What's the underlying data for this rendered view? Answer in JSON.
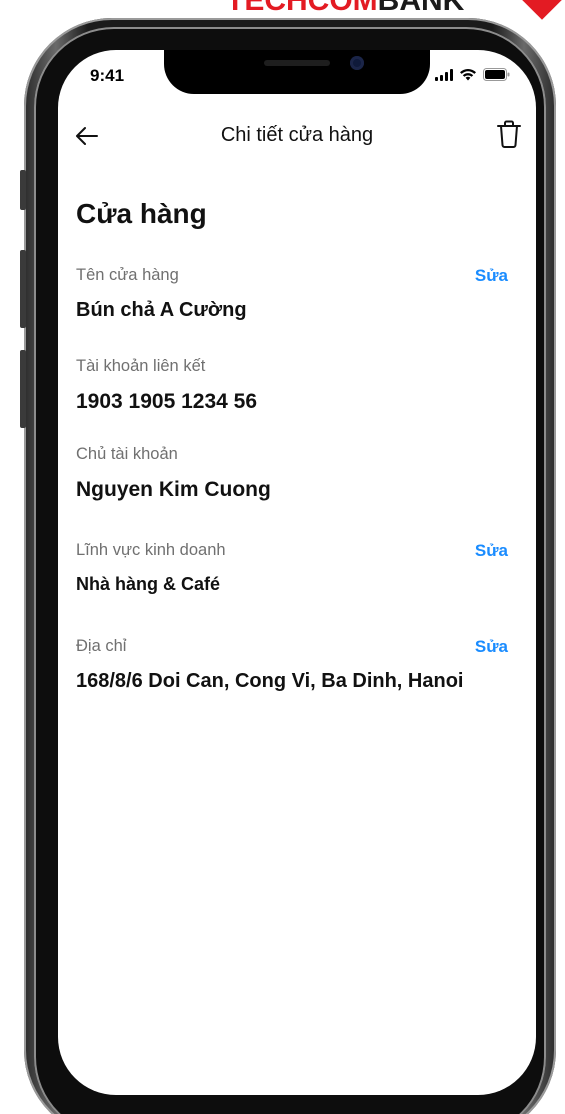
{
  "brand": {
    "text_red": "TECHCOM",
    "text_dark": "BANK",
    "accent": "#e31b23"
  },
  "status_bar": {
    "time": "9:41",
    "icons": [
      "signal-icon",
      "wifi-icon",
      "battery-icon"
    ]
  },
  "header": {
    "title": "Chi tiết cửa hàng",
    "back_icon": "back-arrow-icon",
    "delete_icon": "trash-icon"
  },
  "section": {
    "title": "Cửa hàng"
  },
  "fields": [
    {
      "label": "Tên cửa hàng",
      "value": "Bún chả A Cường",
      "edit": "Sửa"
    },
    {
      "label": "Tài khoản liên kết",
      "value": "1903 1905 1234 56"
    },
    {
      "label": "Chủ tài khoản",
      "value": "Nguyen Kim Cuong"
    },
    {
      "label": "Lĩnh vực kinh doanh",
      "value": "Nhà hàng & Café",
      "edit": "Sửa"
    },
    {
      "label": "Địa chỉ",
      "value": "168/8/6 Doi Can, Cong Vi, Ba Dinh, Hanoi",
      "edit": "Sửa"
    }
  ],
  "colors": {
    "link": "#1a8cff",
    "label": "#707070",
    "text": "#111111"
  }
}
